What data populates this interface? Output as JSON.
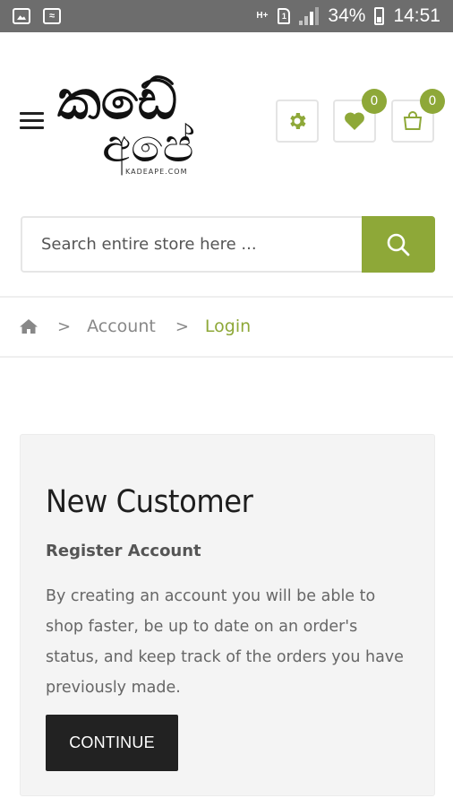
{
  "status_bar": {
    "network": "H+",
    "battery": "34%",
    "time": "14:51"
  },
  "header": {
    "logo_sinhala_top": "කඩේ",
    "logo_sinhala_bottom": "අපේ",
    "logo_domain": "KADEAPE.COM",
    "wishlist_count": "0",
    "cart_count": "0",
    "accent_color": "#8ea838"
  },
  "search": {
    "placeholder": "Search entire store here ..."
  },
  "breadcrumb": {
    "separator": ">",
    "items": [
      "Account",
      "Login"
    ]
  },
  "new_customer": {
    "title": "New Customer",
    "subtitle": "Register Account",
    "description": "By creating an account you will be able to shop faster, be up to date on an order's status, and keep track of the orders you have previously made.",
    "button_label": "CONTINUE"
  },
  "icons": [
    "menu-icon",
    "settings-icon",
    "heart-icon",
    "shopping-bag-icon",
    "search-icon",
    "home-icon"
  ]
}
